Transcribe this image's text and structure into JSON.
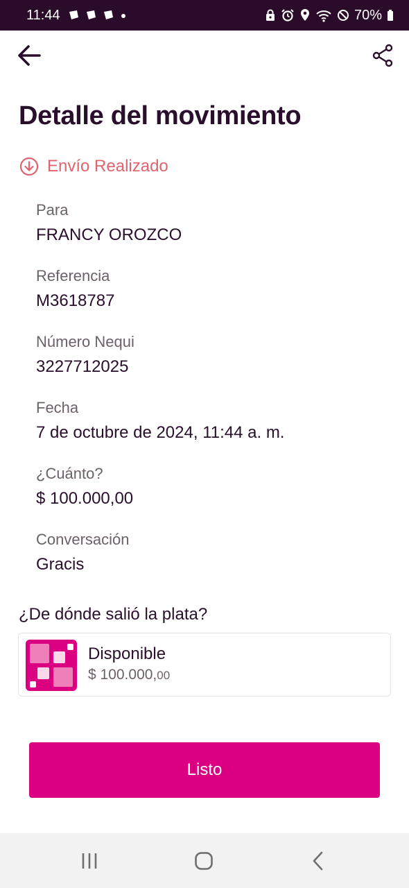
{
  "status_bar": {
    "time": "11:44",
    "battery": "70%"
  },
  "header": {
    "title": "Detalle del movimiento"
  },
  "transaction": {
    "status": "Envío Realizado",
    "status_color": "#e0636e",
    "fields": [
      {
        "label": "Para",
        "value": "FRANCY OROZCO"
      },
      {
        "label": "Referencia",
        "value": "M3618787"
      },
      {
        "label": "Número Nequi",
        "value": "3227712025"
      },
      {
        "label": "Fecha",
        "value": "7 de octubre de 2024, 11:44 a. m."
      },
      {
        "label": "¿Cuánto?",
        "value": "$ 100.000,00"
      },
      {
        "label": "Conversación",
        "value": "Gracis"
      }
    ]
  },
  "source": {
    "heading": "¿De dónde salió la plata?",
    "account_name": "Disponible",
    "amount": "$ 100.000,",
    "amount_cents": "00"
  },
  "actions": {
    "done_label": "Listo"
  },
  "colors": {
    "brand": "#da0081",
    "title": "#2a0f2c",
    "status_bar_bg": "#2b0b2a"
  }
}
